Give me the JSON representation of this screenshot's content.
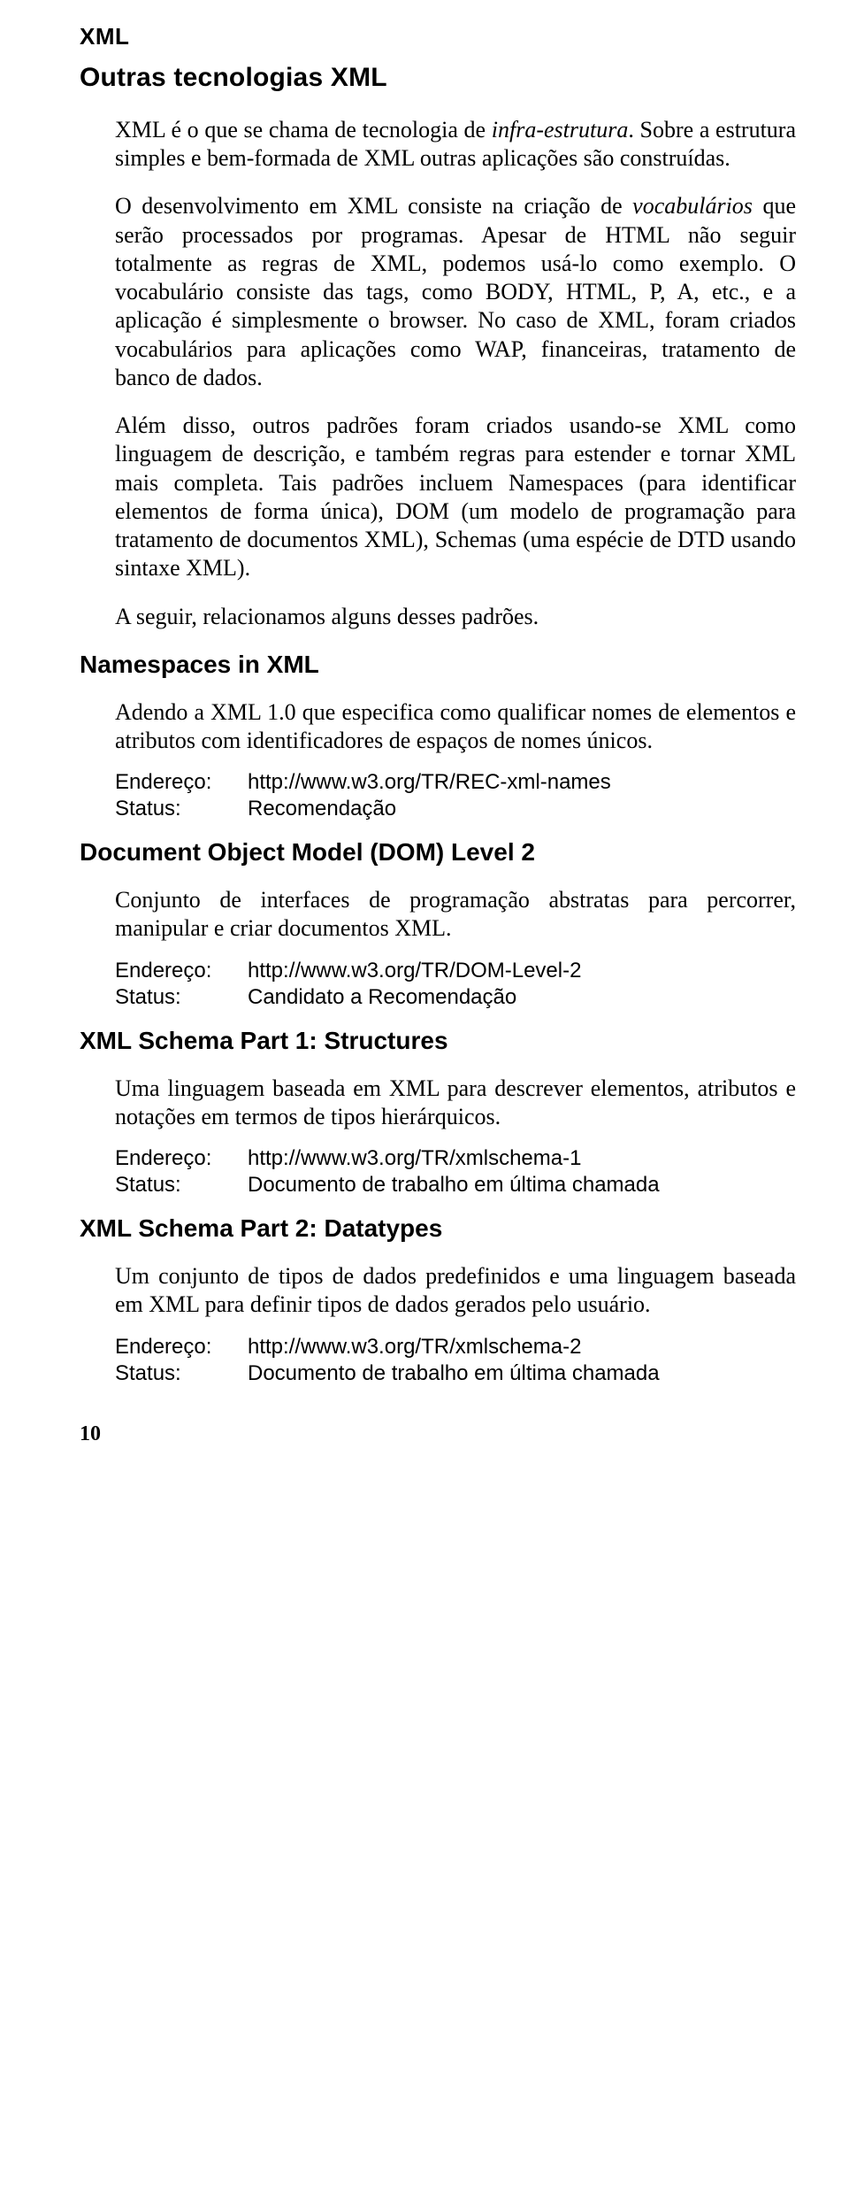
{
  "runhead": "XML",
  "title": "Outras tecnologias XML",
  "intro": {
    "p1_a": "XML é o que se chama de tecnologia de ",
    "p1_i": "infra-estrutura",
    "p1_b": ". Sobre a estrutura simples e bem-formada de XML outras aplicações são construídas.",
    "p2_a": "O desenvolvimento em XML consiste na criação de ",
    "p2_i": "vocabulários",
    "p2_b": " que serão processados por programas. Apesar de HTML não seguir totalmente as regras de XML, podemos usá-lo como exemplo. O vocabulário consiste das tags, como BODY, HTML, P, A, etc., e a aplicação é simplesmente o browser. No caso de XML, foram criados vocabulários para aplicações como WAP, financeiras, tratamento de banco de dados.",
    "p3": "Além disso, outros padrões foram criados usando-se XML como linguagem de descrição, e também regras para estender e tornar XML mais completa. Tais padrões incluem Namespaces (para identificar elementos de forma única), DOM (um modelo de programação para tratamento de documentos XML), Schemas (uma espécie de DTD usando sintaxe XML).",
    "p4": "A seguir, relacionamos alguns desses padrões."
  },
  "labels": {
    "endereco": "Endereço:",
    "status": "Status:"
  },
  "sections": [
    {
      "heading": "Namespaces in XML",
      "body": "Adendo a XML 1.0 que especifica como qualificar nomes de elementos e atributos com identificadores de espaços de nomes únicos.",
      "endereco": "http://www.w3.org/TR/REC-xml-names",
      "status": "Recomendação"
    },
    {
      "heading": "Document Object Model (DOM) Level 2",
      "body": "Conjunto de interfaces de programação abstratas para percorrer, manipular e criar documentos XML.",
      "endereco": "http://www.w3.org/TR/DOM-Level-2",
      "status": "Candidato a Recomendação"
    },
    {
      "heading": "XML Schema Part 1: Structures",
      "body": "Uma linguagem baseada em XML para descrever elementos, atributos e notações em termos de tipos hierárquicos.",
      "endereco": "http://www.w3.org/TR/xmlschema-1",
      "status": "Documento de trabalho em última chamada"
    },
    {
      "heading": "XML Schema Part 2: Datatypes",
      "body": "Um conjunto de tipos de dados predefinidos e uma linguagem baseada em XML para definir tipos de dados gerados pelo usuário.",
      "endereco": "http://www.w3.org/TR/xmlschema-2",
      "status": "Documento de trabalho em última chamada"
    }
  ],
  "page_number": "10"
}
